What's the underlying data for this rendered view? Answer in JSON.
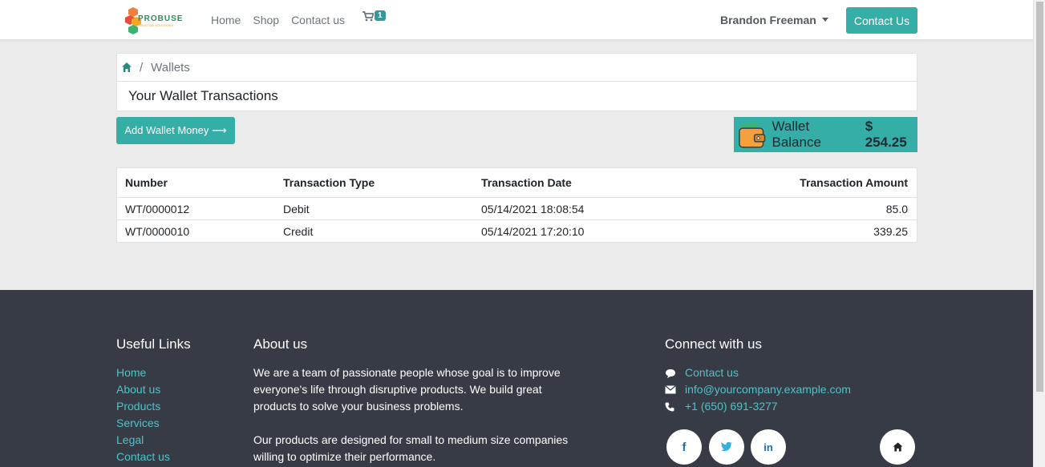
{
  "header": {
    "logo_text": "PROBUSE",
    "logo_sub": "TRUSTED SOLUTIONS",
    "nav": [
      "Home",
      "Shop",
      "Contact us"
    ],
    "cart_count": "1",
    "user_name": "Brandon Freeman",
    "contact_button": "Contact Us"
  },
  "breadcrumb": {
    "current": "Wallets"
  },
  "page_title": "Your Wallet Transactions",
  "add_wallet_button": "Add Wallet Money ⟶",
  "wallet_balance": {
    "label": "Wallet Balance",
    "amount": "$ 254.25"
  },
  "table": {
    "headers": [
      "Number",
      "Transaction Type",
      "Transaction Date",
      "Transaction Amount"
    ],
    "rows": [
      [
        "WT/0000012",
        "Debit",
        "05/14/2021 18:08:54",
        "85.0"
      ],
      [
        "WT/0000010",
        "Credit",
        "05/14/2021 17:20:10",
        "339.25"
      ]
    ]
  },
  "footer": {
    "useful_links_title": "Useful Links",
    "useful_links": [
      "Home",
      "About us",
      "Products",
      "Services",
      "Legal",
      "Contact us"
    ],
    "about_title": "About us",
    "about_p1": "We are a team of passionate people whose goal is to improve everyone's life through disruptive products. We build great products to solve your business problems.",
    "about_p2": "Our products are designed for small to medium size companies willing to optimize their performance.",
    "connect_title": "Connect with us",
    "contact_link": "Contact us",
    "email": "info@yourcompany.example.com",
    "phone": "+1 (650) 691-3277",
    "social": [
      "facebook-icon",
      "twitter-icon",
      "linkedin-icon",
      "home-icon"
    ]
  },
  "colors": {
    "accent": "#35aea8",
    "footer_bg": "#363b45",
    "link": "#4fc3c8"
  }
}
